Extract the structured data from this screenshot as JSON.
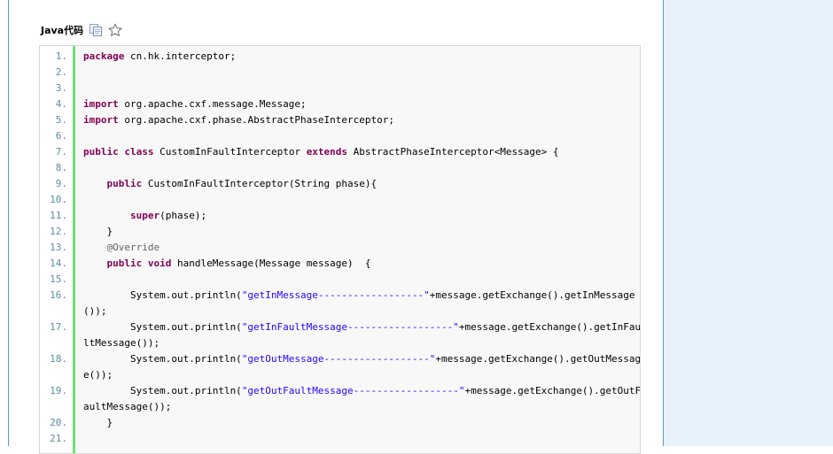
{
  "header": {
    "title": "Java代码",
    "copy_icon": "copy-icon",
    "favorite_icon": "star-icon"
  },
  "colors": {
    "keyword": "#7f0055",
    "string": "#2a00ff",
    "annotation": "#646464",
    "line_number": "#5c8ea3",
    "gutter_border": "#6ce26c",
    "side_panel": "#e8f2fb"
  },
  "code": {
    "line_numbers": [
      "1.",
      "2.",
      "3.",
      "4.",
      "5.",
      "6.",
      "7.",
      "8.",
      "9.",
      "10.",
      "11.",
      "12.",
      "13.",
      "14.",
      "15.",
      "16.",
      "17.",
      "18.",
      "19.",
      "20.",
      "21."
    ],
    "lines": [
      [
        {
          "t": "package",
          "c": "kw"
        },
        {
          "t": " cn.hk.interceptor;"
        }
      ],
      [],
      [],
      [
        {
          "t": "import",
          "c": "kw"
        },
        {
          "t": " org.apache.cxf.message.Message;"
        }
      ],
      [
        {
          "t": "import",
          "c": "kw"
        },
        {
          "t": " org.apache.cxf.phase.AbstractPhaseInterceptor;"
        }
      ],
      [],
      [
        {
          "t": "public",
          "c": "kw"
        },
        {
          "t": " "
        },
        {
          "t": "class",
          "c": "kw"
        },
        {
          "t": " CustomInFaultInterceptor "
        },
        {
          "t": "extends",
          "c": "kw"
        },
        {
          "t": " AbstractPhaseInterceptor<Message> {"
        }
      ],
      [],
      [
        {
          "t": "    "
        },
        {
          "t": "public",
          "c": "kw"
        },
        {
          "t": " CustomInFaultInterceptor(String phase){"
        }
      ],
      [],
      [
        {
          "t": "        "
        },
        {
          "t": "super",
          "c": "kw"
        },
        {
          "t": "(phase);"
        }
      ],
      [
        {
          "t": "    }"
        }
      ],
      [
        {
          "t": "    "
        },
        {
          "t": "@Override",
          "c": "ann"
        }
      ],
      [
        {
          "t": "    "
        },
        {
          "t": "public",
          "c": "kw"
        },
        {
          "t": " "
        },
        {
          "t": "void",
          "c": "kw"
        },
        {
          "t": " handleMessage(Message message)  {"
        }
      ],
      [],
      [
        {
          "t": "        System.out.println("
        },
        {
          "t": "\"getInMessage------------------\"",
          "c": "str"
        },
        {
          "t": "+message.getExchange().getInMessage"
        }
      ],
      [
        {
          "t": "        System.out.println("
        },
        {
          "t": "\"getInFaultMessage------------------\"",
          "c": "str"
        },
        {
          "t": "+message.getExchange().getInFau"
        }
      ],
      [
        {
          "t": "        System.out.println("
        },
        {
          "t": "\"getOutMessage------------------\"",
          "c": "str"
        },
        {
          "t": "+message.getExchange().getOutMessag"
        }
      ],
      [
        {
          "t": "        System.out.println("
        },
        {
          "t": "\"getOutFaultMessage------------------\"",
          "c": "str"
        },
        {
          "t": "+message.getExchange().getOutF"
        }
      ],
      [
        {
          "t": "    }"
        }
      ],
      []
    ],
    "wraps": {
      "15": "());",
      "16": "ltMessage());",
      "17": "e());",
      "18": "aultMessage());"
    }
  }
}
